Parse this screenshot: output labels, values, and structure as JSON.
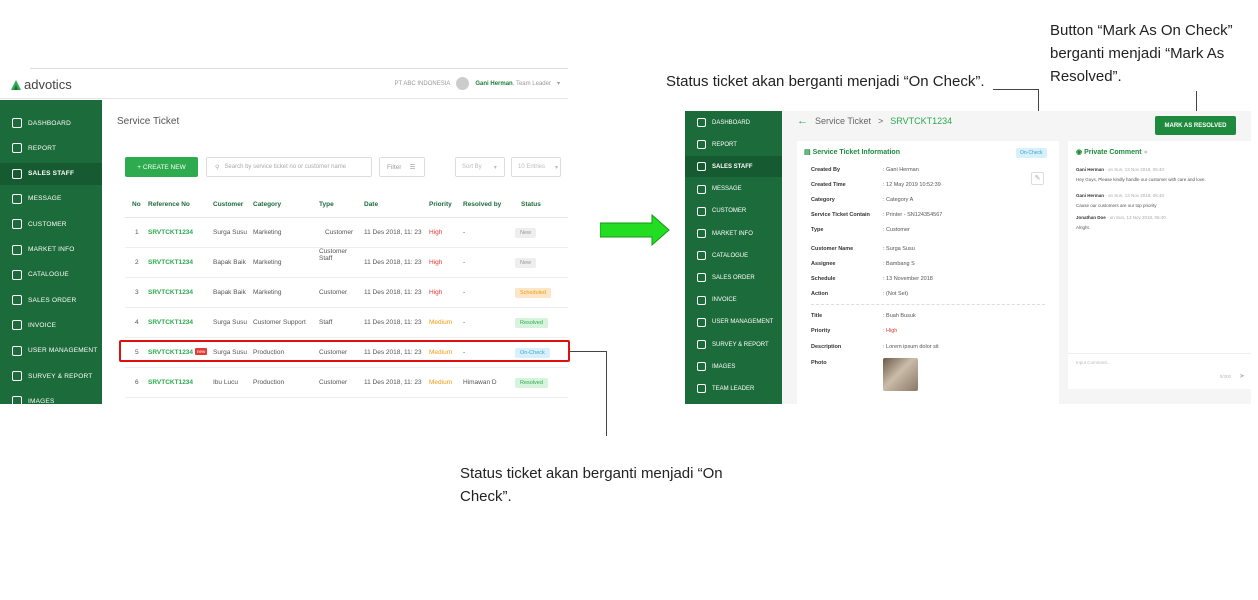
{
  "annotations": {
    "button_note": "Button “Mark As On Check” berganti menjadi “Mark As Resolved”.",
    "status_note_top": "Status ticket akan berganti menjadi “On Check”.",
    "status_note_bottom": "Status ticket akan berganti menjadi “On Check”."
  },
  "left": {
    "logo": "advotics",
    "company": "PT ABC INDONESIA",
    "user": "Gani Herman",
    "role": ", Team Leader",
    "sidebar": [
      "DASHBOARD",
      "REPORT",
      "SALES STAFF",
      "MESSAGE",
      "CUSTOMER",
      "MARKET INFO",
      "CATALOGUE",
      "SALES ORDER",
      "INVOICE",
      "USER MANAGEMENT",
      "SURVEY & REPORT",
      "IMAGES"
    ],
    "title": "Service Ticket",
    "create_btn": "+ CREATE NEW",
    "search_placeholder": "Search by service ticket no or customer name",
    "filter": "Filter",
    "sort": "Sort By",
    "entries": "10 Entries",
    "headers": [
      "No",
      "Reference No",
      "Customer",
      "Category",
      "Type",
      "Date",
      "Priority",
      "Resolved by",
      "Status"
    ],
    "rows": [
      {
        "no": "1",
        "ref": "SRVTCKT1234",
        "customer": "Surga Susu",
        "category": "Marketing",
        "type": "Customer",
        "date": "11 Des 2018, 11: 23",
        "priority": "High",
        "resolved": "-",
        "status": "New"
      },
      {
        "no": "2",
        "ref": "SRVTCKT1234",
        "customer": "Bapak Baik",
        "category": "Marketing",
        "type": "Customer Staff",
        "type2": "Staff",
        "date": "11 Des 2018, 11: 23",
        "priority": "High",
        "resolved": "-",
        "status": "New"
      },
      {
        "no": "3",
        "ref": "SRVTCKT1234",
        "customer": "Bapak Baik",
        "category": "Marketing",
        "type": "Customer",
        "date": "11 Des 2018, 11: 23",
        "priority": "High",
        "resolved": "-",
        "status": "Scheduled"
      },
      {
        "no": "4",
        "ref": "SRVTCKT1234",
        "customer": "Surga Susu",
        "category": "Customer Support",
        "type": "Staff",
        "date": "11 Des 2018, 11: 23",
        "priority": "Medium",
        "resolved": "-",
        "status": "Resolved"
      },
      {
        "no": "5",
        "ref": "SRVTCKT1234",
        "customer": "Surga Susu",
        "category": "Production",
        "type": "Customer",
        "date": "11 Des 2018, 11: 23",
        "priority": "Medium",
        "resolved": "-",
        "status": "On-Check",
        "tag": "new"
      },
      {
        "no": "6",
        "ref": "SRVTCKT1234",
        "customer": "Ibu Lucu",
        "category": "Production",
        "type": "Customer",
        "date": "11 Des 2018, 11: 23",
        "priority": "Medium",
        "resolved": "Himawan D",
        "status": "Resolved"
      }
    ]
  },
  "right": {
    "sidebar": [
      "DASHBOARD",
      "REPORT",
      "SALES STAFF",
      "MESSAGE",
      "CUSTOMER",
      "MARKET INFO",
      "CATALOGUE",
      "SALES ORDER",
      "INVOICE",
      "USER MANAGEMENT",
      "SURVEY & REPORT",
      "IMAGES",
      "TEAM LEADER"
    ],
    "crumb_parent": "Service Ticket",
    "crumb_sep": ">",
    "crumb_id": "SRVTCKT1234",
    "mark_btn": "MARK AS RESOLVED",
    "info_title": "Service Ticket Information",
    "status_badge": "On-Check",
    "fields": [
      {
        "k": "Created By",
        "v": ": Gani Herman"
      },
      {
        "k": "Created Time",
        "v": ": 12 May 2019 10:52:39"
      },
      {
        "k": "Category",
        "v": ": Category A"
      },
      {
        "k": "Service Ticket Contain",
        "v": ": Printer - SN124354567"
      },
      {
        "k": "Type",
        "v": ": Customer"
      },
      {
        "k": "Customer Name",
        "v": ": Surga Susu"
      },
      {
        "k": "Assignee",
        "v": ": Bambang S"
      },
      {
        "k": "Schedule",
        "v": ": 13 November 2018"
      },
      {
        "k": "Action",
        "v": ": (Not Set)"
      },
      {
        "k": "Title",
        "v": ": Buah Busuk"
      },
      {
        "k": "Priority",
        "v": ": High"
      },
      {
        "k": "Description",
        "v": ": Lorem ipsum dolor sit"
      },
      {
        "k": "Photo",
        "v": ""
      }
    ],
    "comment_title": "Private Comment",
    "comments": [
      {
        "name": "Gani Herman",
        "time": " - on Sun, 13 Nov 2018, 06:40",
        "text": "Hey Guys, Please kindly handle our customer with care and love."
      },
      {
        "name": "Gani Herman",
        "time": " - on Sun, 13 Nov 2018, 06:40",
        "text": "Cause our customers are our top priority"
      },
      {
        "name": "Jonathan Doe",
        "time": " - on Sun, 13 Nov 2018, 06:40",
        "text": "Alright."
      }
    ],
    "input_placeholder": "Input Comment...",
    "counter": "0/300"
  },
  "colors": {
    "sidebar": "#1c6b3a",
    "accent": "#2eaa4f",
    "highlight": "#e01010",
    "arrow": "#22dd22"
  }
}
